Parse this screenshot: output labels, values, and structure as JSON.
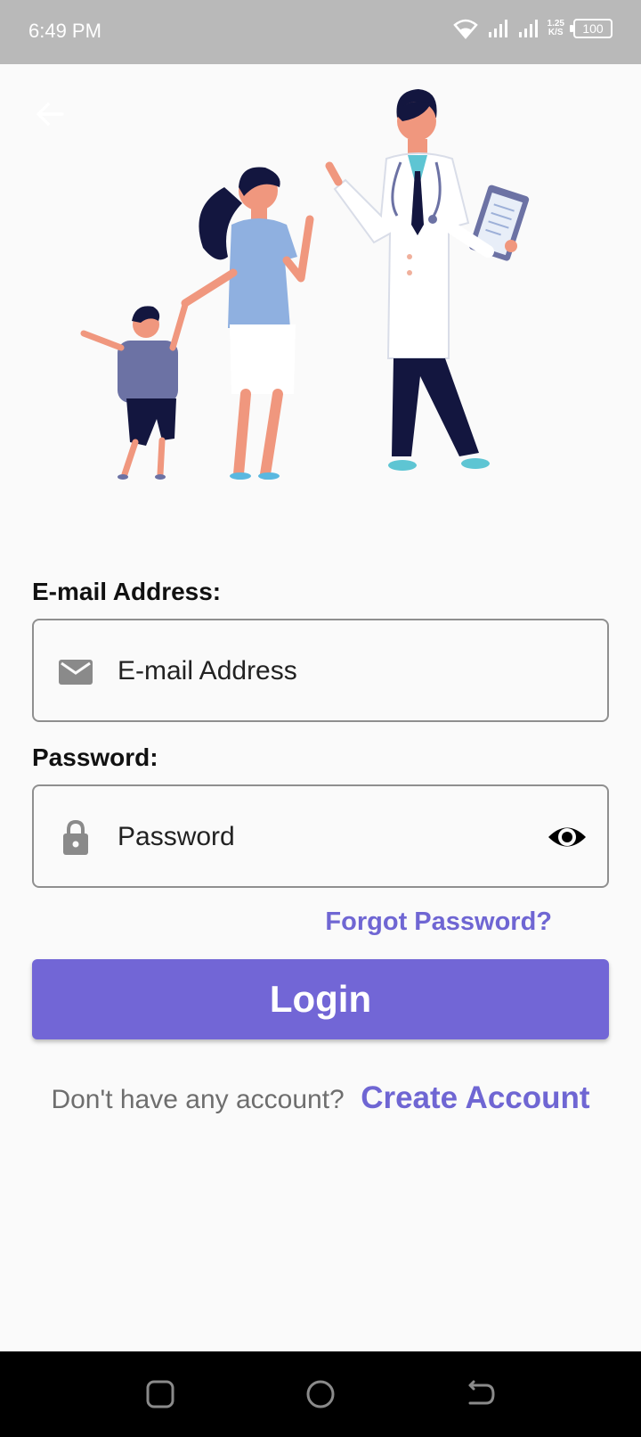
{
  "status_bar": {
    "time": "6:49 PM",
    "net_speed_value": "1.25",
    "net_speed_unit": "K/S",
    "battery": "100",
    "icons": [
      "wifi-icon",
      "signal-icon",
      "signal-icon",
      "battery-icon"
    ]
  },
  "header": {
    "back_icon": "arrow-left-icon"
  },
  "illustration": {
    "description_icon": "family-doctor-illustration"
  },
  "form": {
    "email_label": "E-mail Address:",
    "email_placeholder": "E-mail Address",
    "email_value": "",
    "email_icon": "mail-icon",
    "password_label": "Password:",
    "password_placeholder": "Password",
    "password_value": "",
    "password_icon": "lock-icon",
    "visibility_icon": "eye-icon",
    "forgot_password": "Forgot Password?",
    "login_button": "Login"
  },
  "signup": {
    "prompt": "Don't have any account?",
    "link": "Create Account"
  },
  "colors": {
    "accent": "#7266d6",
    "link": "#6f66d3",
    "status_bar": "#b9b9b9"
  },
  "nav_bar": {
    "icons": [
      "recent-apps-icon",
      "home-icon",
      "back-icon"
    ]
  }
}
